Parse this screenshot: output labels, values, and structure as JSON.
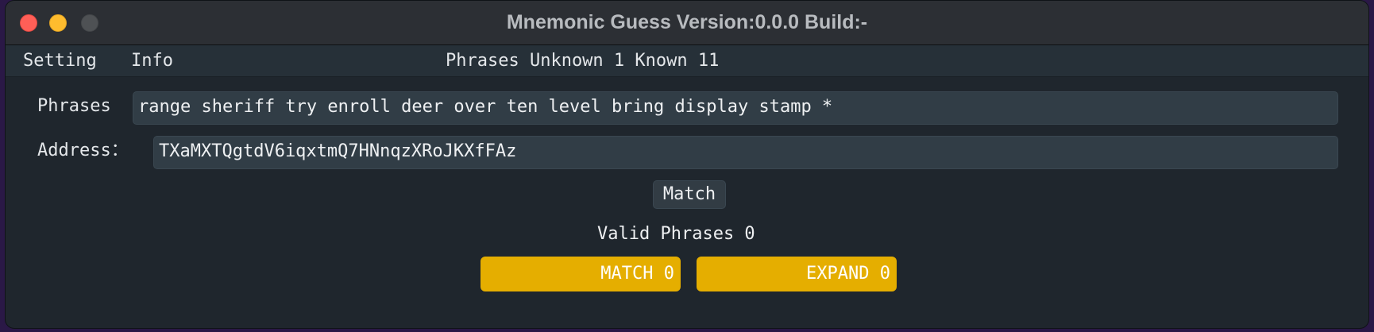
{
  "window": {
    "title": "Mnemonic Guess Version:0.0.0 Build:-"
  },
  "menu": {
    "setting": "Setting",
    "info": "Info",
    "status": "Phrases Unknown 1 Known 11"
  },
  "form": {
    "phrases_label": "Phrases",
    "phrases_value": "range sheriff try enroll deer over ten level bring display stamp *",
    "address_label": "Address：",
    "address_value": "TXaMXTQgtdV6iqxtmQ7HNnqzXRoJKXfFAz",
    "match_label": "Match",
    "valid_label": "Valid Phrases 0"
  },
  "actions": {
    "match_button": "MATCH 0",
    "expand_button": "EXPAND 0"
  },
  "colors": {
    "accent": "#e5ae00",
    "background": "#1f262d",
    "titlebar": "#2c2f34",
    "field": "#313d46"
  }
}
